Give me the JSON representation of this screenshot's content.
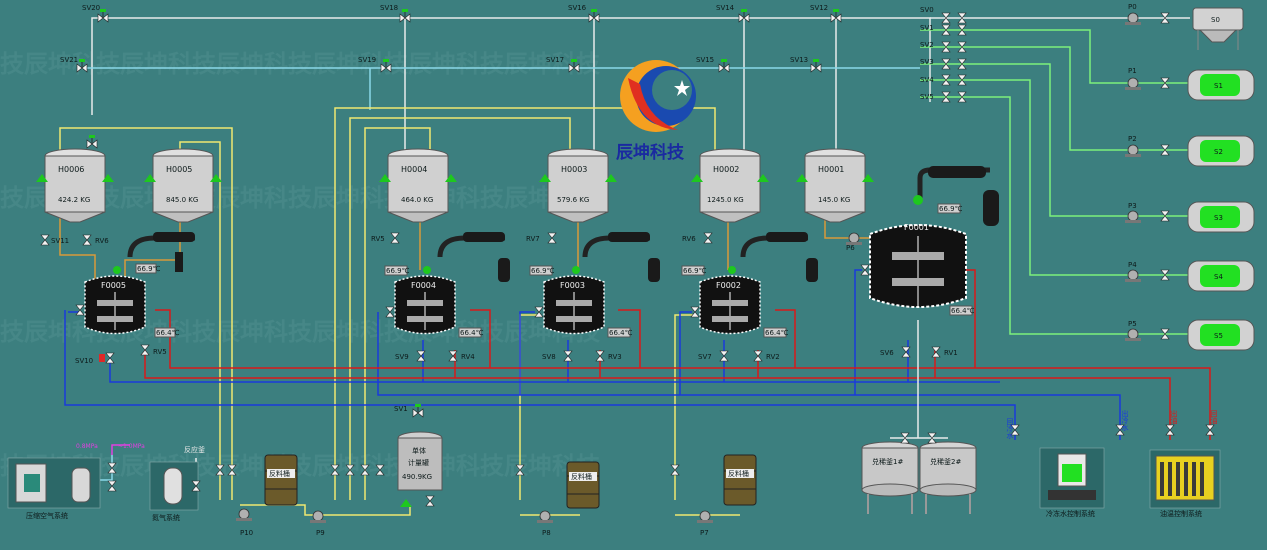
{
  "brand": {
    "name": "辰坤科技"
  },
  "watermark_text": "技辰坤科技辰坤科技辰坤科技辰坤科技辰坤科技辰坤科技",
  "colors": {
    "background": "#3c7f7f",
    "pipe_white": "#e8ecec",
    "pipe_yellow": "#f0e870",
    "pipe_green": "#7cf07c",
    "pipe_blue": "#1a3adc",
    "pipe_red": "#d81a1a",
    "pipe_orange": "#d89a3a",
    "pipe_cyan": "#8ad8e8",
    "material_green": "#22e022",
    "valve_green": "#1ec81e",
    "valve_red": "#e02828"
  },
  "top_valves": [
    "SV20",
    "SV18",
    "SV16",
    "SV14",
    "SV12"
  ],
  "mid_valves": [
    "SV21",
    "SV19",
    "SV17",
    "SV15",
    "SV13"
  ],
  "header_valves": [
    "SV0",
    "SV1",
    "SV2",
    "SV3",
    "SV4",
    "SV5"
  ],
  "pumps_right": [
    "P0",
    "P1",
    "P2",
    "P3",
    "P4",
    "P5"
  ],
  "tanks_right": [
    "S0",
    "S1",
    "S2",
    "S3",
    "S4",
    "S5"
  ],
  "hoppers": [
    {
      "id": "H0006",
      "weight": "424.2 KG"
    },
    {
      "id": "H0005",
      "weight": "845.0 KG"
    },
    {
      "id": "H0004",
      "weight": "464.0 KG"
    },
    {
      "id": "H0003",
      "weight": "579.6 KG"
    },
    {
      "id": "H0002",
      "weight": "1245.0 KG"
    },
    {
      "id": "H0001",
      "weight": "145.0 KG"
    }
  ],
  "reactors": [
    {
      "id": "F0005",
      "temp1": "66.9℃",
      "temp2": "66.4℃",
      "feed_valves": [
        "SV11",
        "RV6"
      ],
      "drain_valve": "SV10",
      "rv": "RV5"
    },
    {
      "id": "F0004",
      "temp1": "66.9℃",
      "temp2": "66.4℃",
      "feed_valves": [
        "RV5"
      ],
      "drain_valve": "SV9",
      "rv": "RV4"
    },
    {
      "id": "F0003",
      "temp1": "66.9℃",
      "temp2": "66.4℃",
      "feed_valves": [
        "RV7"
      ],
      "drain_valve": "SV8",
      "rv": "RV3"
    },
    {
      "id": "F0002",
      "temp1": "66.9℃",
      "temp2": "66.4℃",
      "feed_valves": [
        "RV6"
      ],
      "drain_valve": "SV7",
      "rv": "RV2"
    }
  ],
  "main_reactor": {
    "id": "F0001",
    "temp1": "66.9℃",
    "temp2": "66.4℃",
    "pump": "P6",
    "drain_valve": "SV6",
    "rv": "RV1"
  },
  "bottom_pumps": [
    "P10",
    "P9",
    "P8",
    "P7"
  ],
  "drums": [
    "反料桶",
    "反料桶",
    "反料桶",
    "反料桶"
  ],
  "single_meter": {
    "title_line1": "单体",
    "title_line2": "计量罐",
    "weight": "490.9KG",
    "valve": "SV1"
  },
  "dilution_tanks": [
    "兑稀釜1#",
    "兑稀釜2#"
  ],
  "compressed_air": {
    "label": "压缩空气系统",
    "pressure": "0.8MPa",
    "pressure2": "~1.0MPa"
  },
  "nitrogen": {
    "label": "氮气系统",
    "to": "反应釜"
  },
  "cooling_water": {
    "label": "冷冻水控制系统",
    "return_label": "回冷水",
    "supply_label": "出冷水"
  },
  "hot_oil": {
    "label": "油温控制系统",
    "supply_label": "出油",
    "return_label": "回油"
  }
}
